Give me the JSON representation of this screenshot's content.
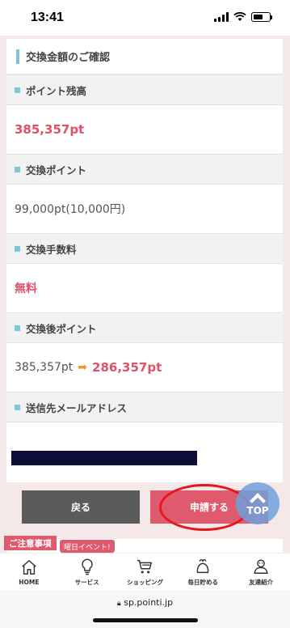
{
  "status": {
    "time": "13:41"
  },
  "card": {
    "title": "交換金額のご確認",
    "sections": [
      {
        "label": "ポイント残高",
        "value": "385,357pt"
      },
      {
        "label": "交換ポイント",
        "value": "99,000pt(10,000円)"
      },
      {
        "label": "交換手数料",
        "value": "無料"
      },
      {
        "label": "交換後ポイント",
        "value_before": "385,357pt",
        "value_after": "286,357pt"
      },
      {
        "label": "送信先メールアドレス"
      }
    ]
  },
  "buttons": {
    "back": "戻る",
    "apply": "申請する",
    "top": "TOP"
  },
  "notice": {
    "tab": "ご注意事項",
    "event": "曜日イベント!"
  },
  "nav": [
    {
      "label": "HOME",
      "icon": "home-icon"
    },
    {
      "label": "サービス",
      "icon": "lightbulb-icon"
    },
    {
      "label": "ショッピング",
      "icon": "cart-icon"
    },
    {
      "label": "毎日貯める",
      "icon": "coin-purse-icon"
    },
    {
      "label": "友達紹介",
      "icon": "friends-icon"
    }
  ],
  "url": "sp.pointi.jp",
  "colors": {
    "accent": "#e05a6e",
    "marker": "#7ec6d6",
    "highlight_circle": "#e8151e"
  }
}
